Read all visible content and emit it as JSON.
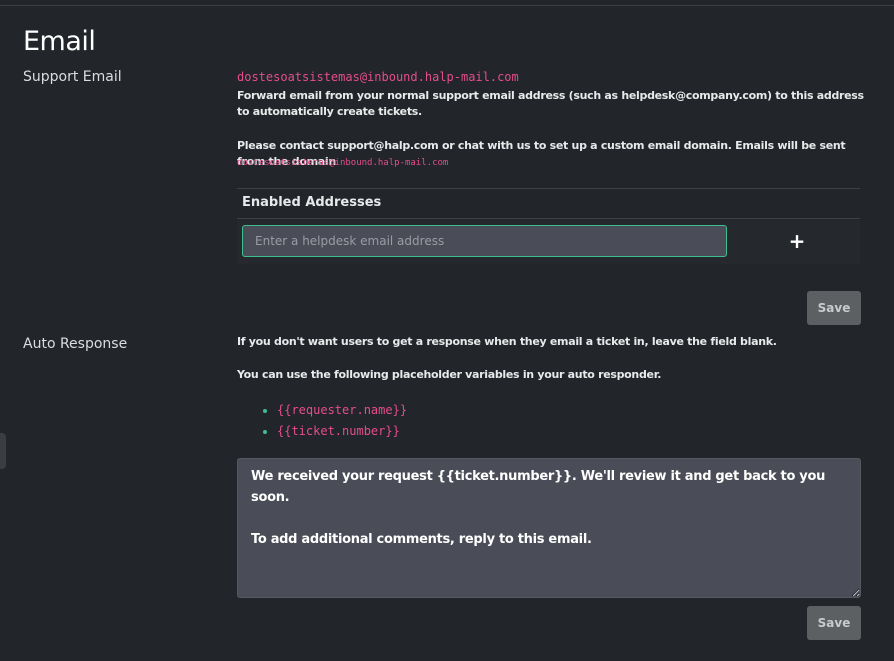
{
  "section": {
    "title": "Email"
  },
  "support_email": {
    "label": "Support Email",
    "address": "dostesoatsistemas@inbound.halp-mail.com",
    "forward_text": "Forward email from your normal support email address (such as helpdesk@company.com) to this address to automatically create tickets.",
    "contact_text": "Please contact support@halp.com or chat with us to set up a custom email domain. Emails will be sent from the domain",
    "domain_address": "dostesoatsistemas@inbound.halp-mail.com"
  },
  "enabled_addresses": {
    "heading": "Enabled Addresses",
    "input_placeholder": "Enter a helpdesk email address",
    "input_value": "",
    "add_label": "+",
    "save_label": "Save"
  },
  "auto_response": {
    "label": "Auto Response",
    "hint_blank": "If you don't want users to get a response when they email a ticket in, leave the field blank.",
    "hint_vars": "You can use the following placeholder variables in your auto responder.",
    "placeholders": [
      "{{requester.name}}",
      "{{ticket.number}}"
    ],
    "message": "We received your request {{ticket.number}}. We'll review it and get back to you soon.\n\nTo add additional comments, reply to this email.",
    "save_label": "Save"
  },
  "colors": {
    "background": "#222529",
    "accent": "#3fbf8f",
    "code": "#e44e8c",
    "input_bg": "#4a4d57",
    "button_bg": "#5c6063"
  }
}
